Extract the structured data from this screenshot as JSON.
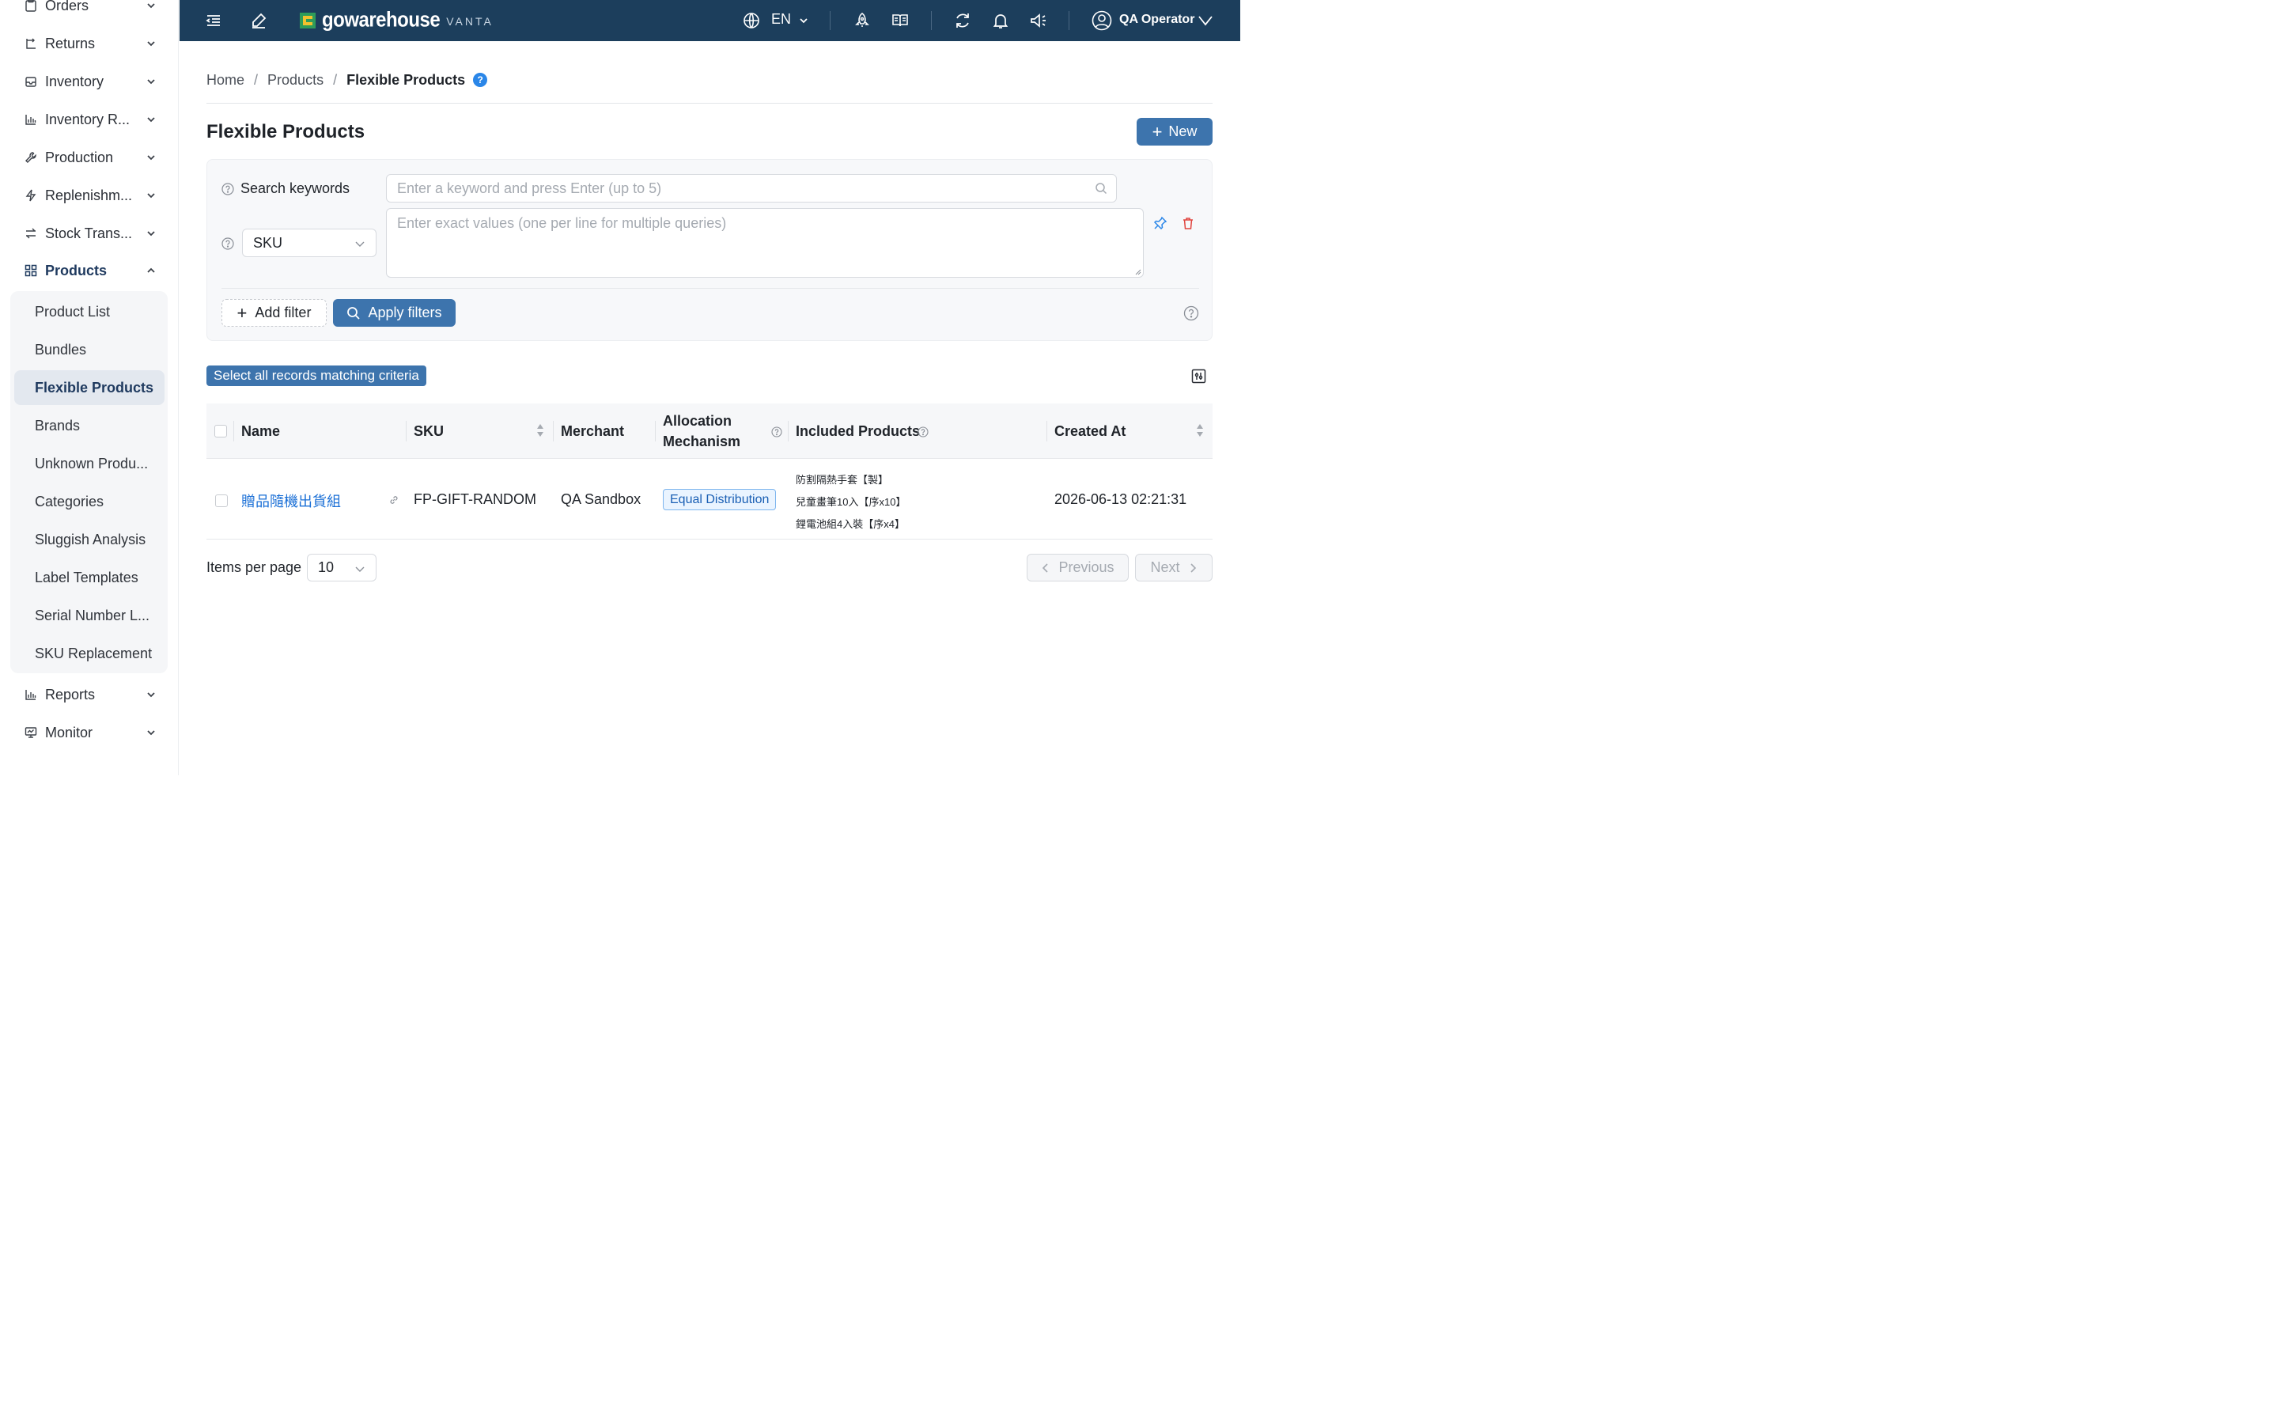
{
  "sidebar": {
    "items": [
      {
        "label": "Orders",
        "icon": "clipboard-icon"
      },
      {
        "label": "Returns",
        "icon": "return-icon"
      },
      {
        "label": "Inventory",
        "icon": "inbox-icon"
      },
      {
        "label": "Inventory R...",
        "icon": "bar-chart-icon"
      },
      {
        "label": "Production",
        "icon": "wrench-icon"
      },
      {
        "label": "Replenishm...",
        "icon": "lightning-icon"
      },
      {
        "label": "Stock Trans...",
        "icon": "transfer-icon"
      },
      {
        "label": "Products",
        "icon": "grid-icon"
      },
      {
        "label": "Reports",
        "icon": "bar-chart-icon"
      },
      {
        "label": "Monitor",
        "icon": "monitor-icon"
      }
    ],
    "products_sub": [
      "Product List",
      "Bundles",
      "Flexible Products",
      "Brands",
      "Unknown Produ...",
      "Categories",
      "Sluggish Analysis",
      "Label Templates",
      "Serial Number L...",
      "SKU Replacement"
    ]
  },
  "topbar": {
    "brand": "gowarehouse",
    "brand_sub": "VANTA",
    "language": "EN",
    "user": "QA Operator"
  },
  "breadcrumb": [
    "Home",
    "Products",
    "Flexible Products"
  ],
  "help_mark": "?",
  "page": {
    "title": "Flexible Products",
    "new_button": "New",
    "plus": "+"
  },
  "filters": {
    "search_label": "Search keywords",
    "search_placeholder": "Enter a keyword and press Enter (up to 5)",
    "field_select": "SKU",
    "exact_placeholder": "Enter exact values (one per line for multiple queries)",
    "add_filter": "Add filter",
    "apply": "Apply filters"
  },
  "select_all": "Select all records matching criteria",
  "table": {
    "columns": {
      "name": "Name",
      "sku": "SKU",
      "merchant": "Merchant",
      "allocation_1": "Allocation",
      "allocation_2": "Mechanism",
      "included": "Included Products",
      "created": "Created At"
    },
    "rows": [
      {
        "name": "贈品隨機出貨組",
        "sku": "FP-GIFT-RANDOM",
        "merchant": "QA Sandbox",
        "allocation": "Equal Distribution",
        "included": [
          "防割隔熱手套【製】",
          "兒童畫筆10入【序x10】",
          "鋰電池組4入裝【序x4】"
        ],
        "created": "2026-06-13 02:21:31"
      }
    ]
  },
  "pagination": {
    "items_per_page_label": "Items per page",
    "items_per_page": "10",
    "previous": "Previous",
    "next": "Next"
  },
  "colors": {
    "topbar": "#1c3e5c",
    "primary": "#3d74ad",
    "link": "#1a6fd6",
    "danger": "#e0443e"
  }
}
